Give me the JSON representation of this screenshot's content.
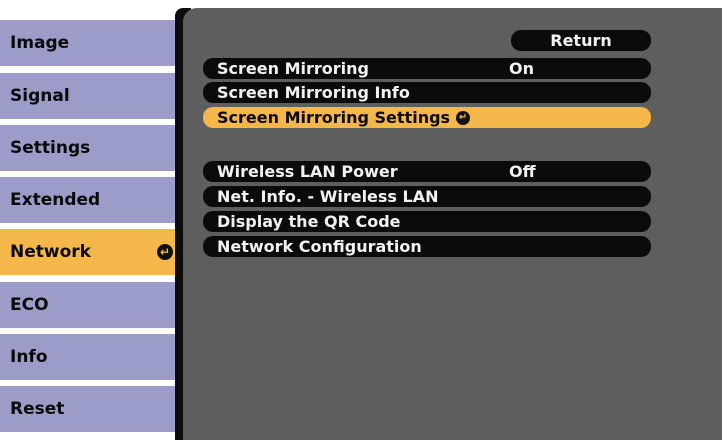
{
  "sidebar": {
    "tabs": [
      {
        "label": "Image"
      },
      {
        "label": "Signal"
      },
      {
        "label": "Settings"
      },
      {
        "label": "Extended"
      },
      {
        "label": "Network",
        "active": true
      },
      {
        "label": "ECO"
      },
      {
        "label": "Info"
      },
      {
        "label": "Reset"
      }
    ],
    "enter_symbol": "↵"
  },
  "panel": {
    "return_label": "Return",
    "items": [
      {
        "label": "Screen Mirroring",
        "value": "On"
      },
      {
        "label": "Screen Mirroring Info",
        "value": ""
      },
      {
        "label": "Screen Mirroring Settings",
        "value": "",
        "selected": true
      },
      {
        "label": "Wireless LAN Power",
        "value": "Off"
      },
      {
        "label": "Net. Info. - Wireless LAN",
        "value": ""
      },
      {
        "label": "Display the QR Code",
        "value": ""
      },
      {
        "label": "Network Configuration",
        "value": ""
      }
    ]
  },
  "colors": {
    "tab_bg": "#9c9cc9",
    "tab_active": "#f5b64a",
    "panel_bg": "#5e5e5e",
    "row_bg": "#0b0b0b",
    "highlight": "#f5b64a"
  }
}
